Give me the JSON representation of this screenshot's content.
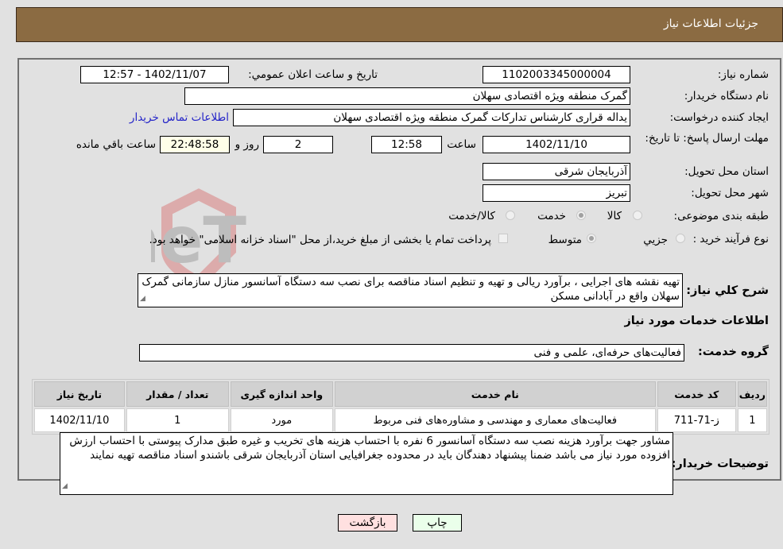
{
  "header": {
    "title": "جزئیات اطلاعات نیاز"
  },
  "form": {
    "need_number_label": "شماره نیاز:",
    "need_number": "1102003345000004",
    "announce_label": "تاریخ و ساعت اعلان عمومي:",
    "announce_value": "1402/11/07 - 12:57",
    "buyer_org_label": "نام دستگاه خريدار:",
    "buyer_org": "گمرک منطقه ویژه اقتصادی سهلان",
    "creator_label": "ایجاد کننده درخواست:",
    "creator": "یداله قراری کارشناس تدارکات گمرک منطقه ویژه اقتصادی سهلان",
    "contact_link": "اطلاعات تماس خریدار",
    "deadline_label": "مهلت ارسال پاسخ: تا تاریخ:",
    "deadline_date": "1402/11/10",
    "time_label": "ساعت",
    "deadline_time": "12:58",
    "days": "2",
    "days_label": "روز و",
    "remaining": "22:48:58",
    "remaining_label": "ساعت باقي مانده",
    "province_label": "استان محل تحویل:",
    "province": "آذربایجان شرقی",
    "city_label": "شهر محل تحویل:",
    "city": "تبریز",
    "category_label": "طبقه بندی موضوعی:",
    "category_options": [
      "کالا",
      "خدمت",
      "کالا/خدمت"
    ],
    "category_selected": "خدمت",
    "purchase_type_label": "نوع فرآیند خرید :",
    "purchase_options": [
      "جزيي",
      "متوسط"
    ],
    "purchase_selected": "متوسط",
    "payment_note": "پرداخت تمام یا بخشی از مبلغ خرید،از محل \"اسناد خزانه اسلامی\" خواهد بود.",
    "description_label": "شرح کلي نياز:",
    "description": "تهیه نقشه های اجرایی  ، برآورد ریالی و تهیه و تنظیم اسناد مناقصه برای نصب سه دستگاه آسانسور منازل سازمانی گمرک سهلان واقع در آبادانی مسکن",
    "services_heading": "اطلاعات خدمات مورد نياز",
    "service_group_label": "گروه خدمت:",
    "service_group": "فعالیت‌های حرفه‌ای، علمی و فنی"
  },
  "table": {
    "headers": [
      "رديف",
      "کد خدمت",
      "نام خدمت",
      "واحد اندازه گیری",
      "تعداد / مقدار",
      "تاریخ نیاز"
    ],
    "rows": [
      [
        "1",
        "ز-71-711",
        "فعالیت‌های معماری و مهندسی و مشاوره‌های فنی مربوط",
        "مورد",
        "1",
        "1402/11/10"
      ]
    ]
  },
  "buyer_notes_label": "توضيحات خريدار:",
  "buyer_notes": "مشاور جهت برآورد هزینه  نصب سه دستگاه  آسانسور 6 نفره با احتساب هزینه های تخریب و غیره طبق مدارک پیوستی با احتساب ارزش افزوده مورد نیاز می باشد ضمنا پیشنهاد دهندگان باید در محدوده جغرافیایی استان آذربایجان شرقی باشندو اسناد مناقصه تهیه نمایند",
  "buttons": {
    "print": "چاپ",
    "back": "بازگشت"
  },
  "watermark": "AriaTender.neT",
  "colors": {
    "header_bg": "#8b6b42",
    "print_bg": "#eaffea",
    "back_bg": "#ffe0e0",
    "link": "#2323c8"
  }
}
